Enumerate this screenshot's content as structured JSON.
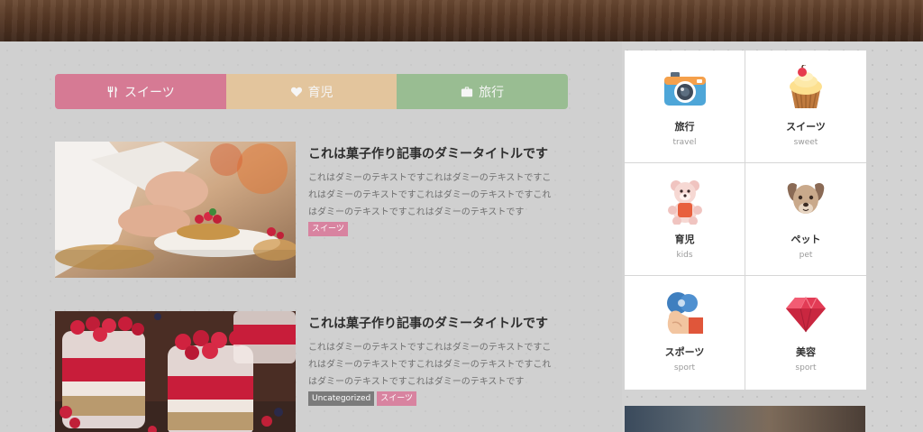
{
  "tabs": [
    {
      "label": "スイーツ",
      "icon": "fork-knife-icon",
      "color": "#d67a94"
    },
    {
      "label": "育児",
      "icon": "heart-icon",
      "color": "#e3c59d"
    },
    {
      "label": "旅行",
      "icon": "suitcase-icon",
      "color": "#99bd92"
    }
  ],
  "articles": [
    {
      "title": "これは菓子作り記事のダミータイトルです",
      "excerpt": [
        "これはダミーのテキストですこれはダミーのテキストですこ",
        "れはダミーのテキストですこれはダミーのテキストですこれ",
        "はダミーのテキストですこれはダミーのテキストです"
      ],
      "tags": [
        "スイーツ"
      ],
      "image": "pastry-chef-photo"
    },
    {
      "title": "これは菓子作り記事のダミータイトルです",
      "excerpt": [
        "これはダミーのテキストですこれはダミーのテキストですこ",
        "れはダミーのテキストですこれはダミーのテキストですこれ",
        "はダミーのテキストですこれはダミーのテキストです"
      ],
      "tags": [
        "Uncategorized",
        "スイーツ"
      ],
      "image": "raspberry-parfait-photo"
    }
  ],
  "categories": [
    {
      "name": "旅行",
      "sub": "travel",
      "icon": "camera-icon"
    },
    {
      "name": "スイーツ",
      "sub": "sweet",
      "icon": "cupcake-icon"
    },
    {
      "name": "育児",
      "sub": "kids",
      "icon": "teddy-bear-icon"
    },
    {
      "name": "ペット",
      "sub": "pet",
      "icon": "dog-icon"
    },
    {
      "name": "スポーツ",
      "sub": "sport",
      "icon": "muscle-arm-icon"
    },
    {
      "name": "美容",
      "sub": "sport",
      "icon": "gem-icon"
    }
  ],
  "colors": {
    "header_wood": "#5a3b27",
    "tag_sweets": "#d883a0",
    "tag_uncategorized": "#7b7b7b"
  }
}
